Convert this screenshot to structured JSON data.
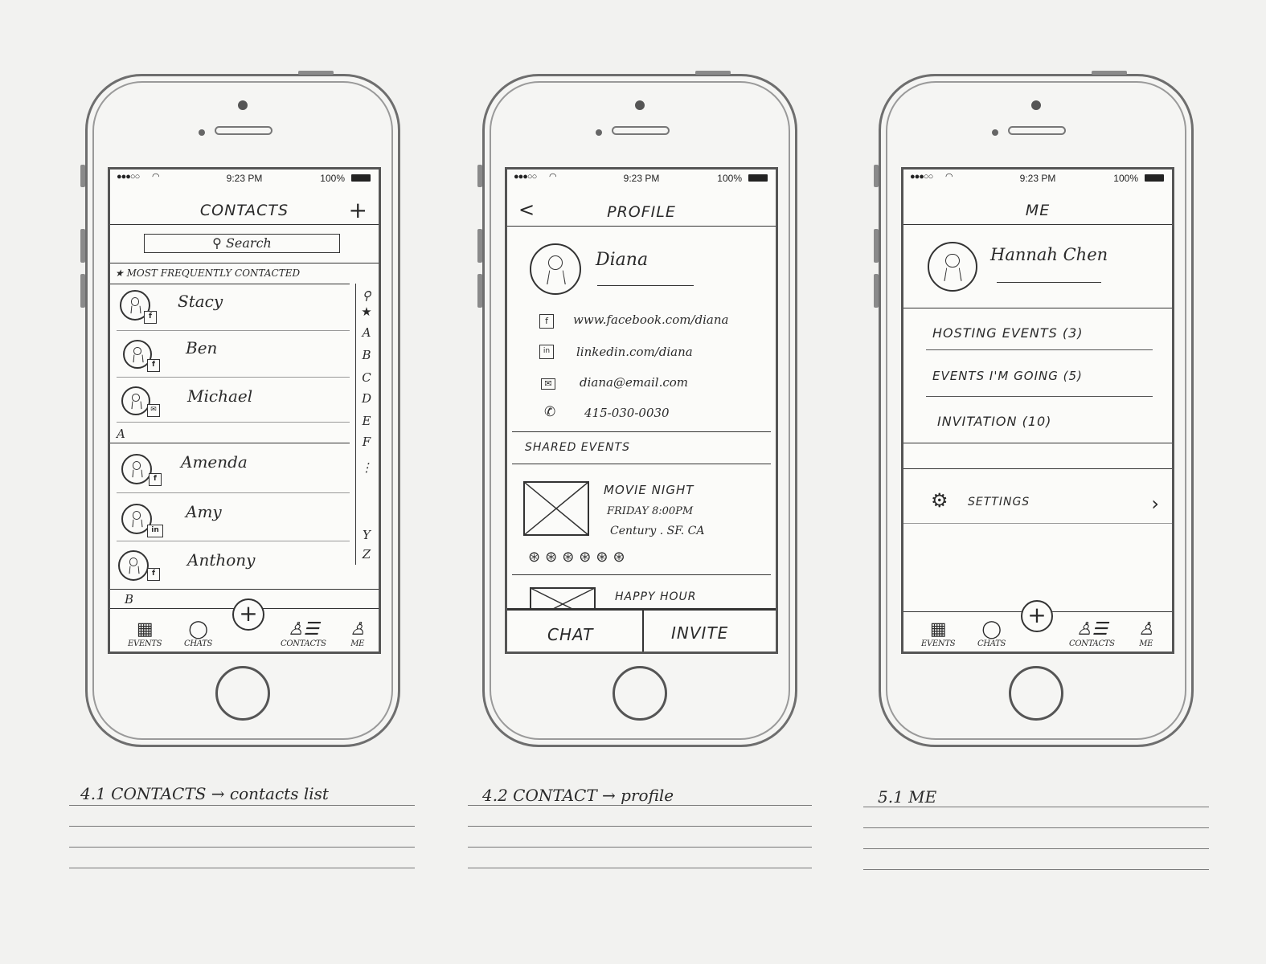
{
  "status": {
    "signal": "●●●○○",
    "time": "9:23 PM",
    "battery": "100%"
  },
  "screens": {
    "contacts": {
      "title": "CONTACTS",
      "add": "+",
      "search_placeholder": "Search",
      "section_frequent": "MOST FREQUENTLY CONTACTED",
      "frequent": [
        {
          "name": "Stacy",
          "badge": "f"
        },
        {
          "name": "Ben",
          "badge": "f"
        },
        {
          "name": "Michael",
          "badge": "✉"
        }
      ],
      "section_a": "A",
      "a_contacts": [
        {
          "name": "Amenda",
          "badge": "f"
        },
        {
          "name": "Amy",
          "badge": "in"
        },
        {
          "name": "Anthony",
          "badge": "f"
        }
      ],
      "section_b": "B",
      "index": [
        "★",
        "A",
        "B",
        "C",
        "D",
        "E",
        "F",
        "Y",
        "Z"
      ],
      "caption": "4.1  CONTACTS → contacts list"
    },
    "profile": {
      "title": "PROFILE",
      "back": "<",
      "name": "Diana",
      "facebook": "www.facebook.com/diana",
      "linkedin": "linkedin.com/diana",
      "email": "diana@email.com",
      "phone": "415-030-0030",
      "shared_events": "SHARED EVENTS",
      "event1": {
        "title": "MOVIE NIGHT",
        "time": "FRIDAY 8:00PM",
        "place": "Century . SF. CA"
      },
      "event2": {
        "title": "HAPPY HOUR"
      },
      "chat": "CHAT",
      "invite": "INVITE",
      "caption": "4.2  CONTACT → profile"
    },
    "me": {
      "title": "ME",
      "name": "Hannah Chen",
      "hosting": "HOSTING EVENTS  (3)",
      "going": "EVENTS I'M GOING  (5)",
      "invitation": "INVITATION  (10)",
      "settings": "SETTINGS",
      "caption": "5.1  ME"
    }
  },
  "tabbar": {
    "events": "EVENTS",
    "chats": "CHATS",
    "contacts": "CONTACTS",
    "me": "ME",
    "fab": "+"
  }
}
